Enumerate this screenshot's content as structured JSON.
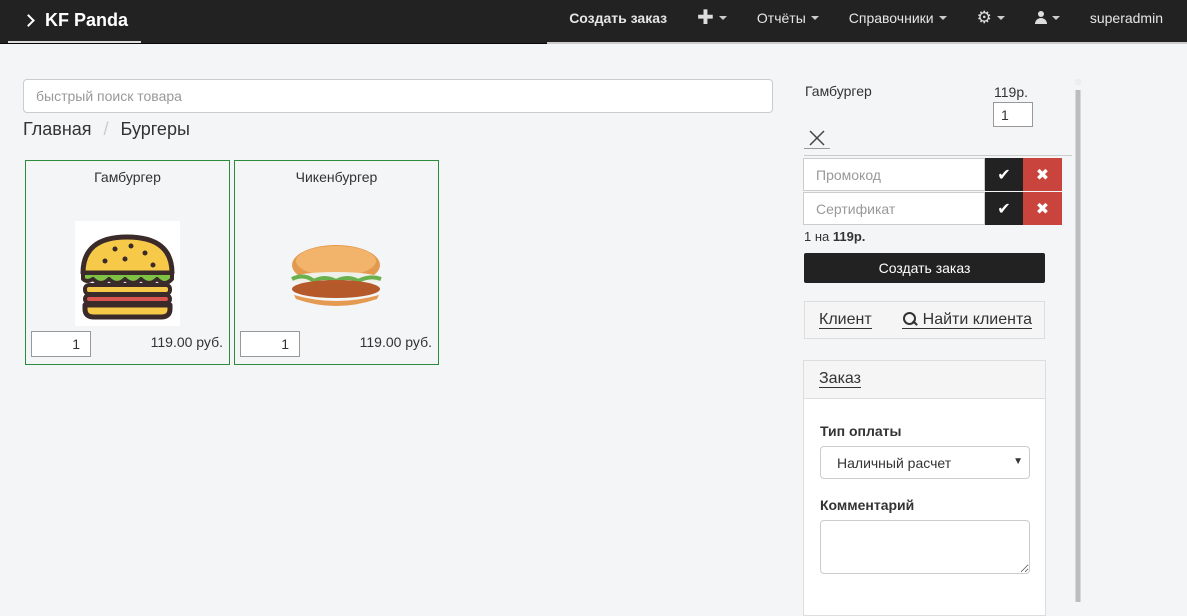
{
  "navbar": {
    "brand": "KF Panda",
    "items": {
      "create_order": "Создать заказ",
      "reports": "Отчёты",
      "directories": "Справочники",
      "username": "superadmin"
    }
  },
  "search": {
    "placeholder": "быстрый поиск товара"
  },
  "breadcrumb": {
    "home": "Главная",
    "separator": "/",
    "current": "Бургеры"
  },
  "products": [
    {
      "name": "Гамбургер",
      "qty": "1",
      "price": "119.00 руб."
    },
    {
      "name": "Чикенбургер",
      "qty": "1",
      "price": "119.00 руб."
    }
  ],
  "cart": {
    "item_name": "Гамбургер",
    "item_price": "119р.",
    "item_qty": "1",
    "promocode_placeholder": "Промокод",
    "certificate_placeholder": "Сертификат",
    "summary_prefix": "1 на ",
    "summary_total": "119р.",
    "create_button": "Создать заказ"
  },
  "client": {
    "label": "Клиент",
    "find": "Найти клиента"
  },
  "order": {
    "title": "Заказ",
    "payment_label": "Тип оплаты",
    "payment_value": "Наличный расчет",
    "comment_label": "Комментарий"
  },
  "colors": {
    "navbar": "#222222",
    "card_border": "#2e8b3e",
    "danger": "#c9443c"
  }
}
